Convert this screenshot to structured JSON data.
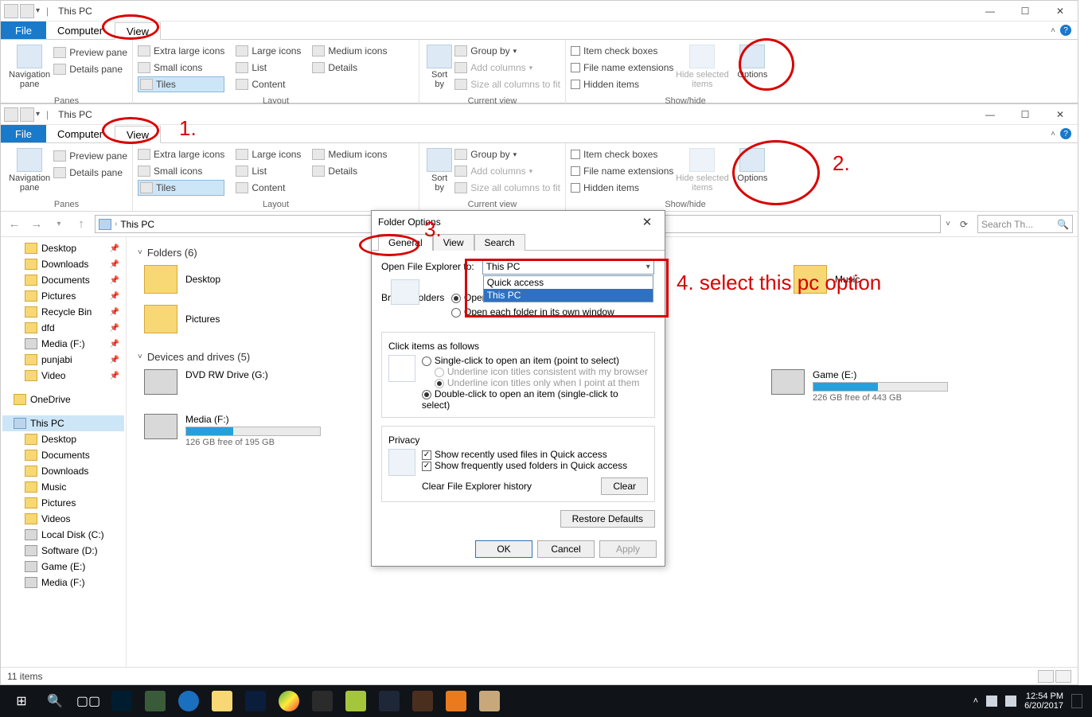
{
  "win1": {
    "title": "This PC",
    "tabs": {
      "file": "File",
      "computer": "Computer",
      "view": "View"
    },
    "ribbon": {
      "panes": {
        "nav": "Navigation\npane",
        "preview": "Preview pane",
        "details": "Details pane",
        "group": "Panes"
      },
      "layout": {
        "xlarge": "Extra large icons",
        "large": "Large icons",
        "medium": "Medium icons",
        "small": "Small icons",
        "list": "List",
        "details": "Details",
        "tiles": "Tiles",
        "content": "Content",
        "group": "Layout"
      },
      "sort": {
        "sort": "Sort\nby",
        "groupby": "Group by",
        "addcols": "Add columns",
        "sizecols": "Size all columns to fit",
        "group": "Current view"
      },
      "show": {
        "itemchk": "Item check boxes",
        "ext": "File name extensions",
        "hidden": "Hidden items",
        "hide": "Hide selected\nitems",
        "options": "Options",
        "group": "Show/hide"
      }
    }
  },
  "win2": {
    "title": "This PC",
    "addr": "This PC",
    "search_ph": "Search Th...",
    "nav": {
      "items": [
        {
          "label": "Desktop",
          "pin": true
        },
        {
          "label": "Downloads",
          "pin": true
        },
        {
          "label": "Documents",
          "pin": true
        },
        {
          "label": "Pictures",
          "pin": true
        },
        {
          "label": "Recycle Bin",
          "pin": true
        },
        {
          "label": "dfd",
          "pin": true
        },
        {
          "label": "Media (F:)",
          "pin": true,
          "drive": true
        },
        {
          "label": "punjabi",
          "pin": true
        },
        {
          "label": "Video",
          "pin": true
        }
      ],
      "onedrive": "OneDrive",
      "thispc": "This PC",
      "pcitems": [
        {
          "label": "Desktop"
        },
        {
          "label": "Documents"
        },
        {
          "label": "Downloads"
        },
        {
          "label": "Music"
        },
        {
          "label": "Pictures"
        },
        {
          "label": "Videos"
        },
        {
          "label": "Local Disk (C:)",
          "drive": true
        },
        {
          "label": "Software (D:)",
          "drive": true
        },
        {
          "label": "Game (E:)",
          "drive": true
        },
        {
          "label": "Media (F:)",
          "drive": true
        }
      ]
    },
    "content": {
      "folders_hdr": "Folders (6)",
      "folders": [
        "Desktop",
        "Pictures",
        "Music"
      ],
      "drives_hdr": "Devices and drives (5)",
      "drives": [
        {
          "name": "DVD RW Drive (G:)",
          "sub": "",
          "fill": 0
        },
        {
          "name": "Game (E:)",
          "sub": "226 GB free of 443 GB",
          "fill": 48
        },
        {
          "name": "Media (F:)",
          "sub": "126 GB free of 195 GB",
          "fill": 35
        }
      ]
    },
    "status": "11 items"
  },
  "dialog": {
    "title": "Folder Options",
    "tabs": {
      "general": "General",
      "view": "View",
      "search": "Search"
    },
    "open_lbl": "Open File Explorer to:",
    "open_val": "This PC",
    "open_opts": [
      "Quick access",
      "This PC"
    ],
    "browse_lbl": "Browse folders",
    "browse_same": "Open each folder in the same window",
    "browse_own": "Open each folder in its own window",
    "click_lbl": "Click items as follows",
    "click_single": "Single-click to open an item (point to select)",
    "click_ul_browser": "Underline icon titles consistent with my browser",
    "click_ul_point": "Underline icon titles only when I point at them",
    "click_double": "Double-click to open an item (single-click to select)",
    "privacy_lbl": "Privacy",
    "priv_files": "Show recently used files in Quick access",
    "priv_folders": "Show frequently used folders in Quick access",
    "priv_clear_lbl": "Clear File Explorer history",
    "clear_btn": "Clear",
    "restore_btn": "Restore Defaults",
    "ok": "OK",
    "cancel": "Cancel",
    "apply": "Apply"
  },
  "annotations": {
    "n1": "1.",
    "n2": "2.",
    "n3": "3.",
    "n4": "4. select this pc option"
  },
  "taskbar": {
    "time": "12:54 PM",
    "date": "6/20/2017"
  }
}
